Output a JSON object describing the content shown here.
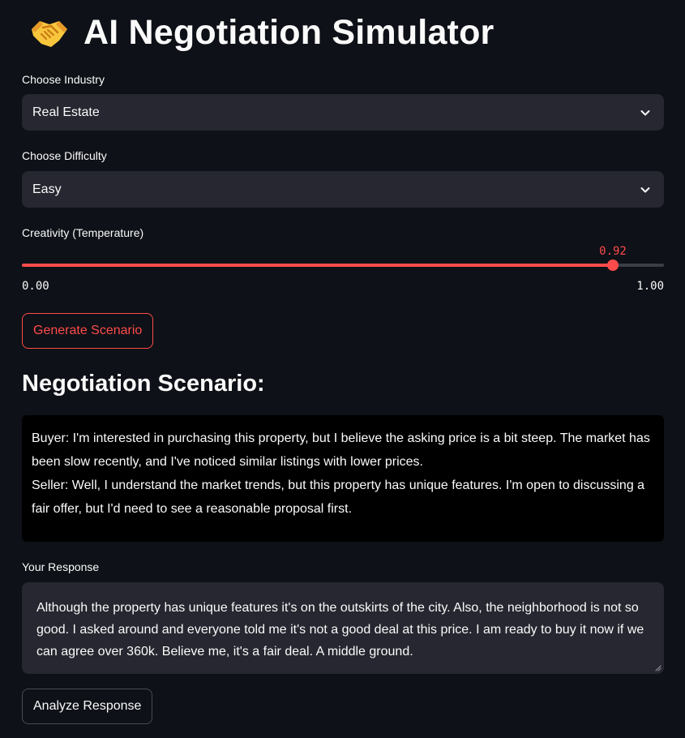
{
  "header": {
    "icon": "handshake-icon",
    "title": "AI Negotiation Simulator"
  },
  "industry": {
    "label": "Choose Industry",
    "selected": "Real Estate"
  },
  "difficulty": {
    "label": "Choose Difficulty",
    "selected": "Easy"
  },
  "creativity": {
    "label": "Creativity (Temperature)",
    "value": 0.92,
    "value_display": "0.92",
    "min": 0.0,
    "max": 1.0,
    "min_display": "0.00",
    "max_display": "1.00"
  },
  "generate_button": "Generate Scenario",
  "scenario": {
    "heading": "Negotiation Scenario:",
    "lines": [
      "Buyer: I'm interested in purchasing this property, but I believe the asking price is a bit steep. The market has been slow recently, and I've noticed similar listings with lower prices.",
      "Seller: Well, I understand the market trends, but this property has unique features. I'm open to discussing a fair offer, but I'd need to see a reasonable proposal first."
    ]
  },
  "response": {
    "label": "Your Response",
    "value": "Although the property has unique features it's on the outskirts of the city. Also, the neighborhood is not so good. I asked around and everyone told me it's not a good deal at this price. I am ready to buy it now if we can agree over 360k. Believe me, it's a fair deal. A middle ground."
  },
  "analyze_button": "Analyze Response",
  "colors": {
    "background": "#0e1117",
    "widget": "#262730",
    "accent": "#ff4b4b",
    "text": "#fafafa"
  }
}
